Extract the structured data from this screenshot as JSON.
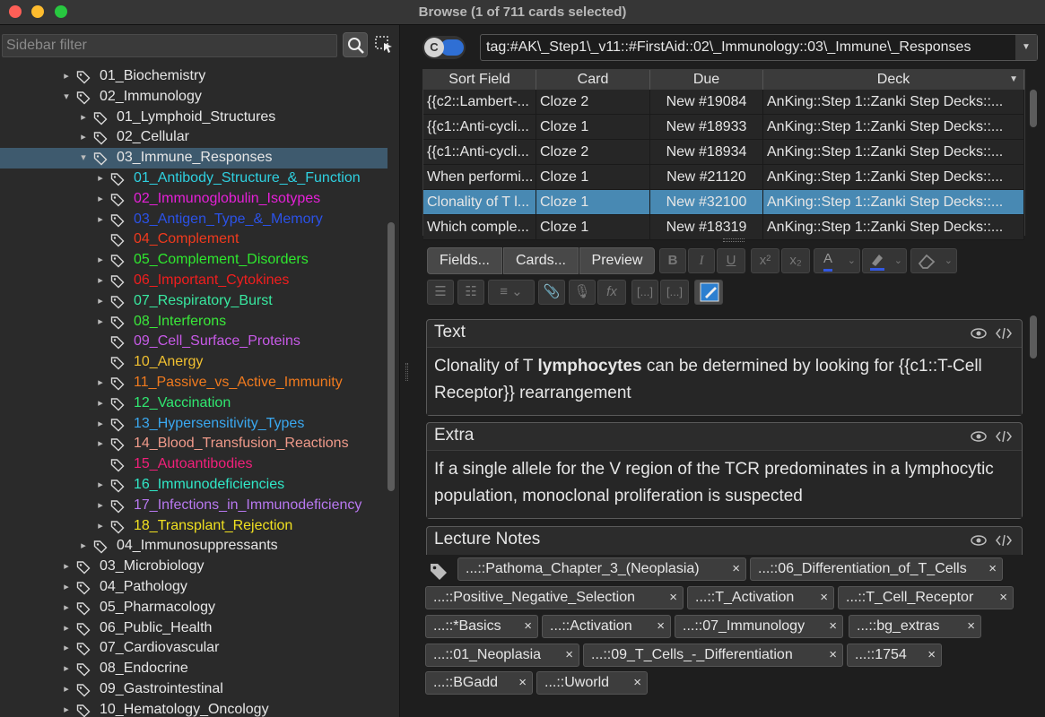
{
  "window": {
    "title": "Browse (1 of 711 cards selected)"
  },
  "sidebar": {
    "filter_placeholder": "Sidebar filter",
    "items": [
      {
        "label": "01_Biochemistry",
        "level": 0,
        "chev": "right",
        "color": "#e6e6e6"
      },
      {
        "label": "02_Immunology",
        "level": 0,
        "chev": "down",
        "color": "#e6e6e6"
      },
      {
        "label": "01_Lymphoid_Structures",
        "level": 1,
        "chev": "right",
        "color": "#e6e6e6"
      },
      {
        "label": "02_Cellular",
        "level": 1,
        "chev": "right",
        "color": "#e6e6e6"
      },
      {
        "label": "03_Immune_Responses",
        "level": 1,
        "chev": "down",
        "color": "#e6e6e6",
        "selected": true
      },
      {
        "label": "01_Antibody_Structure_&_Function",
        "level": 2,
        "chev": "right",
        "color": "#2fd0e0"
      },
      {
        "label": "02_Immunoglobulin_Isotypes",
        "level": 2,
        "chev": "right",
        "color": "#e620d8"
      },
      {
        "label": "03_Antigen_Type_&_Memory",
        "level": 2,
        "chev": "right",
        "color": "#2b52e8"
      },
      {
        "label": "04_Complement",
        "level": 2,
        "chev": "",
        "color": "#f03a1e"
      },
      {
        "label": "05_Complement_Disorders",
        "level": 2,
        "chev": "right",
        "color": "#2ee82e"
      },
      {
        "label": "06_Important_Cytokines",
        "level": 2,
        "chev": "right",
        "color": "#f01e1e"
      },
      {
        "label": "07_Respiratory_Burst",
        "level": 2,
        "chev": "right",
        "color": "#38e8a0"
      },
      {
        "label": "08_Interferons",
        "level": 2,
        "chev": "right",
        "color": "#3ae83a"
      },
      {
        "label": "09_Cell_Surface_Proteins",
        "level": 2,
        "chev": "",
        "color": "#c85ae8"
      },
      {
        "label": "10_Anergy",
        "level": 2,
        "chev": "",
        "color": "#f0c030"
      },
      {
        "label": "11_Passive_vs_Active_Immunity",
        "level": 2,
        "chev": "right",
        "color": "#f07a1e"
      },
      {
        "label": "12_Vaccination",
        "level": 2,
        "chev": "right",
        "color": "#30e870"
      },
      {
        "label": "13_Hypersensitivity_Types",
        "level": 2,
        "chev": "right",
        "color": "#3aa8f0"
      },
      {
        "label": "14_Blood_Transfusion_Reactions",
        "level": 2,
        "chev": "right",
        "color": "#f09a8a"
      },
      {
        "label": "15_Autoantibodies",
        "level": 2,
        "chev": "",
        "color": "#f0207a"
      },
      {
        "label": "16_Immunodeficiencies",
        "level": 2,
        "chev": "right",
        "color": "#30e8c8"
      },
      {
        "label": "17_Infections_in_Immunodeficiency",
        "level": 2,
        "chev": "right",
        "color": "#b878f0"
      },
      {
        "label": "18_Transplant_Rejection",
        "level": 2,
        "chev": "right",
        "color": "#f0e020"
      },
      {
        "label": "04_Immunosuppressants",
        "level": 1,
        "chev": "right",
        "color": "#e6e6e6"
      },
      {
        "label": "03_Microbiology",
        "level": 0,
        "chev": "right",
        "color": "#e6e6e6"
      },
      {
        "label": "04_Pathology",
        "level": 0,
        "chev": "right",
        "color": "#e6e6e6"
      },
      {
        "label": "05_Pharmacology",
        "level": 0,
        "chev": "right",
        "color": "#e6e6e6"
      },
      {
        "label": "06_Public_Health",
        "level": 0,
        "chev": "right",
        "color": "#e6e6e6"
      },
      {
        "label": "07_Cardiovascular",
        "level": 0,
        "chev": "right",
        "color": "#e6e6e6"
      },
      {
        "label": "08_Endocrine",
        "level": 0,
        "chev": "right",
        "color": "#e6e6e6"
      },
      {
        "label": "09_Gastrointestinal",
        "level": 0,
        "chev": "right",
        "color": "#e6e6e6"
      },
      {
        "label": "10_Hematology_Oncology",
        "level": 0,
        "chev": "right",
        "color": "#e6e6e6"
      }
    ]
  },
  "search": {
    "toggle_label": "C",
    "query": "tag:#AK\\_Step1\\_v11::#FirstAid::02\\_Immunology::03\\_Immune\\_Responses"
  },
  "table": {
    "columns": [
      "Sort Field",
      "Card",
      "Due",
      "Deck"
    ],
    "rows": [
      {
        "sort": "{{c2::Lambert-...",
        "card": "Cloze 2",
        "due": "New #19084",
        "deck": "AnKing::Step 1::Zanki Step Decks::...",
        "selected": false
      },
      {
        "sort": "{{c1::Anti-cycli...",
        "card": "Cloze 1",
        "due": "New #18933",
        "deck": "AnKing::Step 1::Zanki Step Decks::...",
        "selected": false
      },
      {
        "sort": "{{c1::Anti-cycli...",
        "card": "Cloze 2",
        "due": "New #18934",
        "deck": "AnKing::Step 1::Zanki Step Decks::...",
        "selected": false
      },
      {
        "sort": "When performi...",
        "card": "Cloze 1",
        "due": "New #21120",
        "deck": "AnKing::Step 1::Zanki Step Decks::...",
        "selected": false
      },
      {
        "sort": "Clonality of T l...",
        "card": "Cloze 1",
        "due": "New #32100",
        "deck": "AnKing::Step 1::Zanki Step Decks::...",
        "selected": true
      },
      {
        "sort": "Which comple...",
        "card": "Cloze 1",
        "due": "New #18319",
        "deck": "AnKing::Step 1::Zanki Step Decks::...",
        "selected": false
      }
    ]
  },
  "editor": {
    "tabs": [
      "Fields...",
      "Cards...",
      "Preview"
    ],
    "toolbar": {
      "bold": "B",
      "italic": "I",
      "underline": "U",
      "superscript": "x²",
      "subscript": "x₂",
      "font_color": "A",
      "cloze": "[...]",
      "cloze_same": "[...]",
      "mathjax": "fx"
    },
    "fields": [
      {
        "name": "Text",
        "before": "Clonality of T ",
        "bold": "lymphocytes",
        "after": " can be determined by looking for {{c1::T-Cell Receptor}} rearrangement"
      },
      {
        "name": "Extra",
        "before": "If a single allele for the V region of the TCR predominates in a lymphocytic population, monoclonal proliferation is suspected",
        "bold": "",
        "after": ""
      },
      {
        "name": "Lecture Notes",
        "before": "",
        "bold": "",
        "after": ""
      }
    ]
  },
  "tags": [
    "...::Pathoma_Chapter_3_(Neoplasia)",
    "...::06_Differentiation_of_T_Cells",
    "...::Positive_Negative_Selection",
    "...::T_Activation",
    "...::T_Cell_Receptor",
    "...::*Basics",
    "...::Activation",
    "...::07_Immunology",
    "...::bg_extras",
    "...::01_Neoplasia",
    "...::09_T_Cells_-_Differentiation",
    "...::1754",
    "...::BGadd",
    "...::Uworld"
  ],
  "tag_remove_glyph": "×"
}
